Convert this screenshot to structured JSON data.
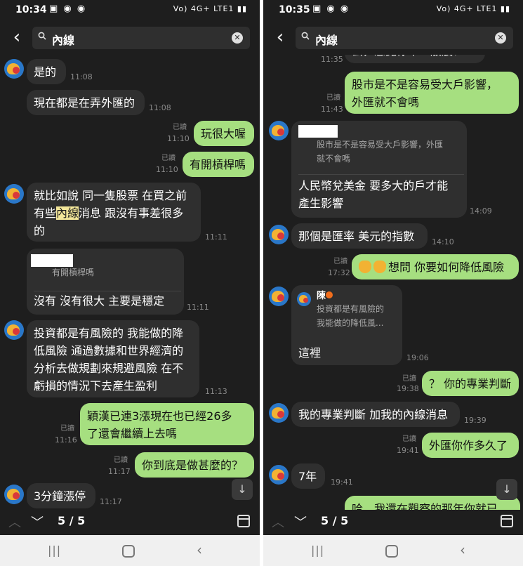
{
  "left": {
    "status": {
      "time": "10:34",
      "icons": "▣ ◉ ◉",
      "sys": "Vo) 4G+ LTE1 ▮▮"
    },
    "search_query": "內線",
    "messages": {
      "m1": {
        "text": "是的",
        "time": "11:08"
      },
      "m2": {
        "text": "現在都是在弄外匯的",
        "time": "11:08"
      },
      "m3": {
        "text": "玩很大喔",
        "read": "已讀",
        "time": "11:10"
      },
      "m4": {
        "text": "有開槓桿嗎",
        "read": "已讀",
        "time": "11:10"
      },
      "m5": {
        "l1": "就比如說 同一隻股票 在買之前",
        "l2a": "有些",
        "l2hl": "內線",
        "l2b": "消息 跟沒有事差很多",
        "l3": "的",
        "time": "11:11"
      },
      "m6": {
        "quote": "有開槓桿嗎",
        "text": "沒有  沒有很大  主要是穩定",
        "time": "11:11"
      },
      "m7": {
        "l1": "投資都是有風險的 我能做的降",
        "l2": "低風險 通過數據和世界經濟的",
        "l3": "分析去做規劃來規避風險 在不",
        "l4": "虧損的情況下去產生盈利",
        "time": "11:13"
      },
      "m8": {
        "l1": "穎漢已連3漲現在也已經26多",
        "l2": "了還會繼續上去嗎",
        "read": "已讀",
        "time": "11:16"
      },
      "m9": {
        "text": "你到底是做甚麼的？",
        "read": "已讀",
        "time": "11:17"
      },
      "m10": {
        "text": "3分鐘漲停",
        "time": "11:17"
      }
    },
    "counter": "5 / 5"
  },
  "right": {
    "status": {
      "time": "10:35",
      "icons": "▣ ◉ ◉",
      "sys": "Vo) 4G+ LTE1 ▮▮"
    },
    "search_query": "內線",
    "messages": {
      "m0": {
        "text": "云，感覺你不一般股？",
        "time": "11:35"
      },
      "m1": {
        "l1": "股市是不是容易受大戶影響，",
        "l2": "外匯就不會嗎",
        "read": "已讀",
        "time": "11:43"
      },
      "m2": {
        "q1": "股市是不是容易受大戶影響，外匯",
        "q2": "就不會嗎",
        "l1": "人民幣兌美金   要多大的戶才能",
        "l2": "產生影響",
        "time": "14:09"
      },
      "m3": {
        "text": "那個是匯率  美元的指數",
        "time": "14:10"
      },
      "m4": {
        "text": "想問  你要如何降低風險",
        "read": "已讀",
        "time": "17:32"
      },
      "m5": {
        "name": "陳",
        "q1": "投資都是有風險的",
        "q2": "我能做的降低風...",
        "text": "這裡",
        "time": "19:06"
      },
      "m6": {
        "text": "？ 你的專業判斷",
        "read": "已讀",
        "time": "19:38"
      },
      "m7": {
        "text": "我的專業判斷 加我的內線消息",
        "time": "19:39"
      },
      "m8": {
        "text": "外匯你作多久了",
        "read": "已讀",
        "time": "19:41"
      },
      "m9": {
        "text": "7年",
        "time": "19:41"
      },
      "m10": {
        "text": "哈，我還在觀察的那年你就已"
      }
    },
    "counter": "5 / 5"
  },
  "icons": {
    "back": "chevron-left",
    "search": "magnifier",
    "clear": "close-circle",
    "calendar": "calendar",
    "scroll": "arrow-down"
  },
  "colors": {
    "bg": "#1e1e1e",
    "incoming": "#2f2f2f",
    "outgoing": "#a6df80",
    "highlight": "#f4e79a"
  }
}
